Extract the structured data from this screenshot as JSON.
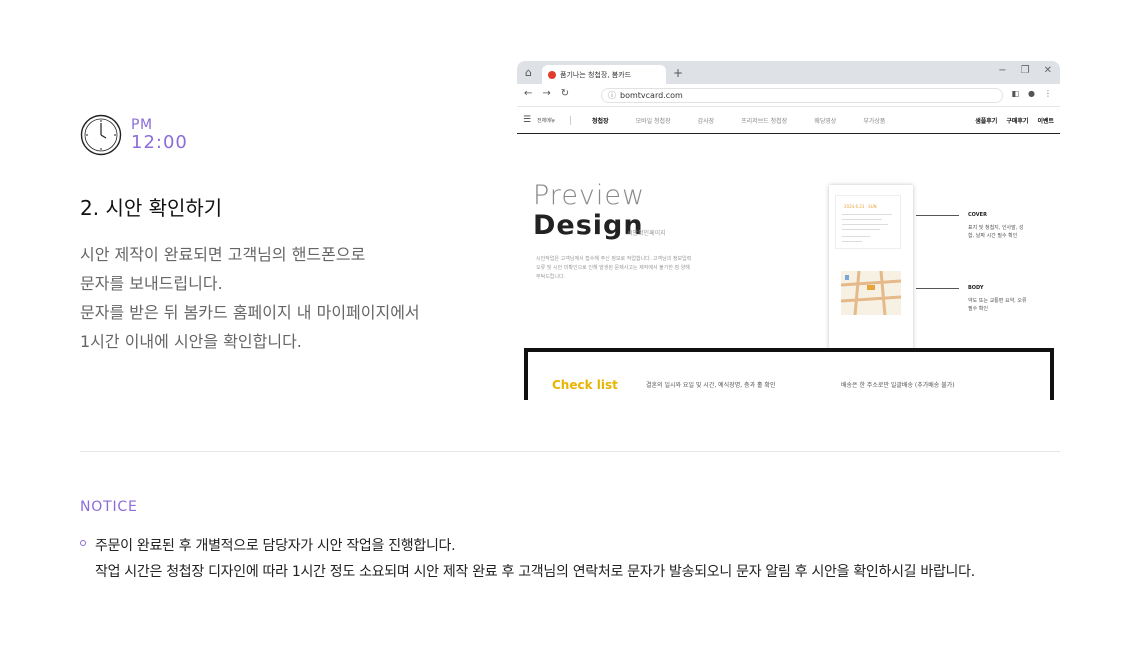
{
  "step": {
    "time_ampm": "PM",
    "time_value": "12:00",
    "icon": "clock-icon",
    "title": "2. 시안 확인하기",
    "description": [
      "시안 제작이 완료되면 고객님의 핸드폰으로",
      "문자를 보내드립니다.",
      "문자를 받은 뒤 봄카드 홈페이지 내 마이페이지에서",
      "1시간 이내에 시안을 확인합니다."
    ]
  },
  "browser": {
    "tab_title": "품기나는 청첩장, 봄카드",
    "new_tab": "+",
    "window_controls": [
      "−",
      "❐",
      "✕"
    ],
    "url": "bomtvcard.com",
    "nav": {
      "all_menu": "전체메뉴",
      "items": [
        "청첩장",
        "모바일 청첩장",
        "감사장",
        "프리저브드 청첩장",
        "웨딩영상",
        "부가상품"
      ],
      "right_items": [
        "샘플후기",
        "구매후기",
        "이벤트"
      ]
    },
    "hero": {
      "preview": "Preview",
      "design": "Design",
      "subtitle": "시안확인페이지",
      "desc": "시안작업은 고객님께서 접수해 주신 정보로 작업합니다. 고객님의 정보입력 오류 및 시안 미확인으로 인해 발생된 문제사고는 제작에서 불가한 점 양해 부탁드립니다.",
      "card_date": "2024.6.23 · SUN",
      "annotations": [
        {
          "title": "COVER",
          "text": "표지 및 청첩지, 인사말, 성함, 날짜 시간 필수 확인"
        },
        {
          "title": "BODY",
          "text": "약도 또는 교통편 요약, 오류 필수 확인"
        }
      ]
    },
    "checklist": {
      "title": "Check list",
      "item1": "결혼의 일시와 요일 및 시간, 예식장명, 층과 홀 확인",
      "item2": "배송은 한 주소로만 일괄배송 (추가배송 불가)"
    }
  },
  "notice": {
    "title": "NOTICE",
    "lines": [
      "주문이 완료된 후 개별적으로 담당자가 시안 작업을 진행합니다.",
      "작업 시간은 청첩장 디자인에 따라 1시간 정도 소요되며 시안 제작 완료 후 고객님의 연락처로 문자가 발송되오니 문자 알림 후 시안을 확인하시길 바랍니다."
    ]
  },
  "colors": {
    "accent": "#8c6cd9",
    "checklist_title": "#e8b400",
    "favicon": "#e23a2c"
  }
}
